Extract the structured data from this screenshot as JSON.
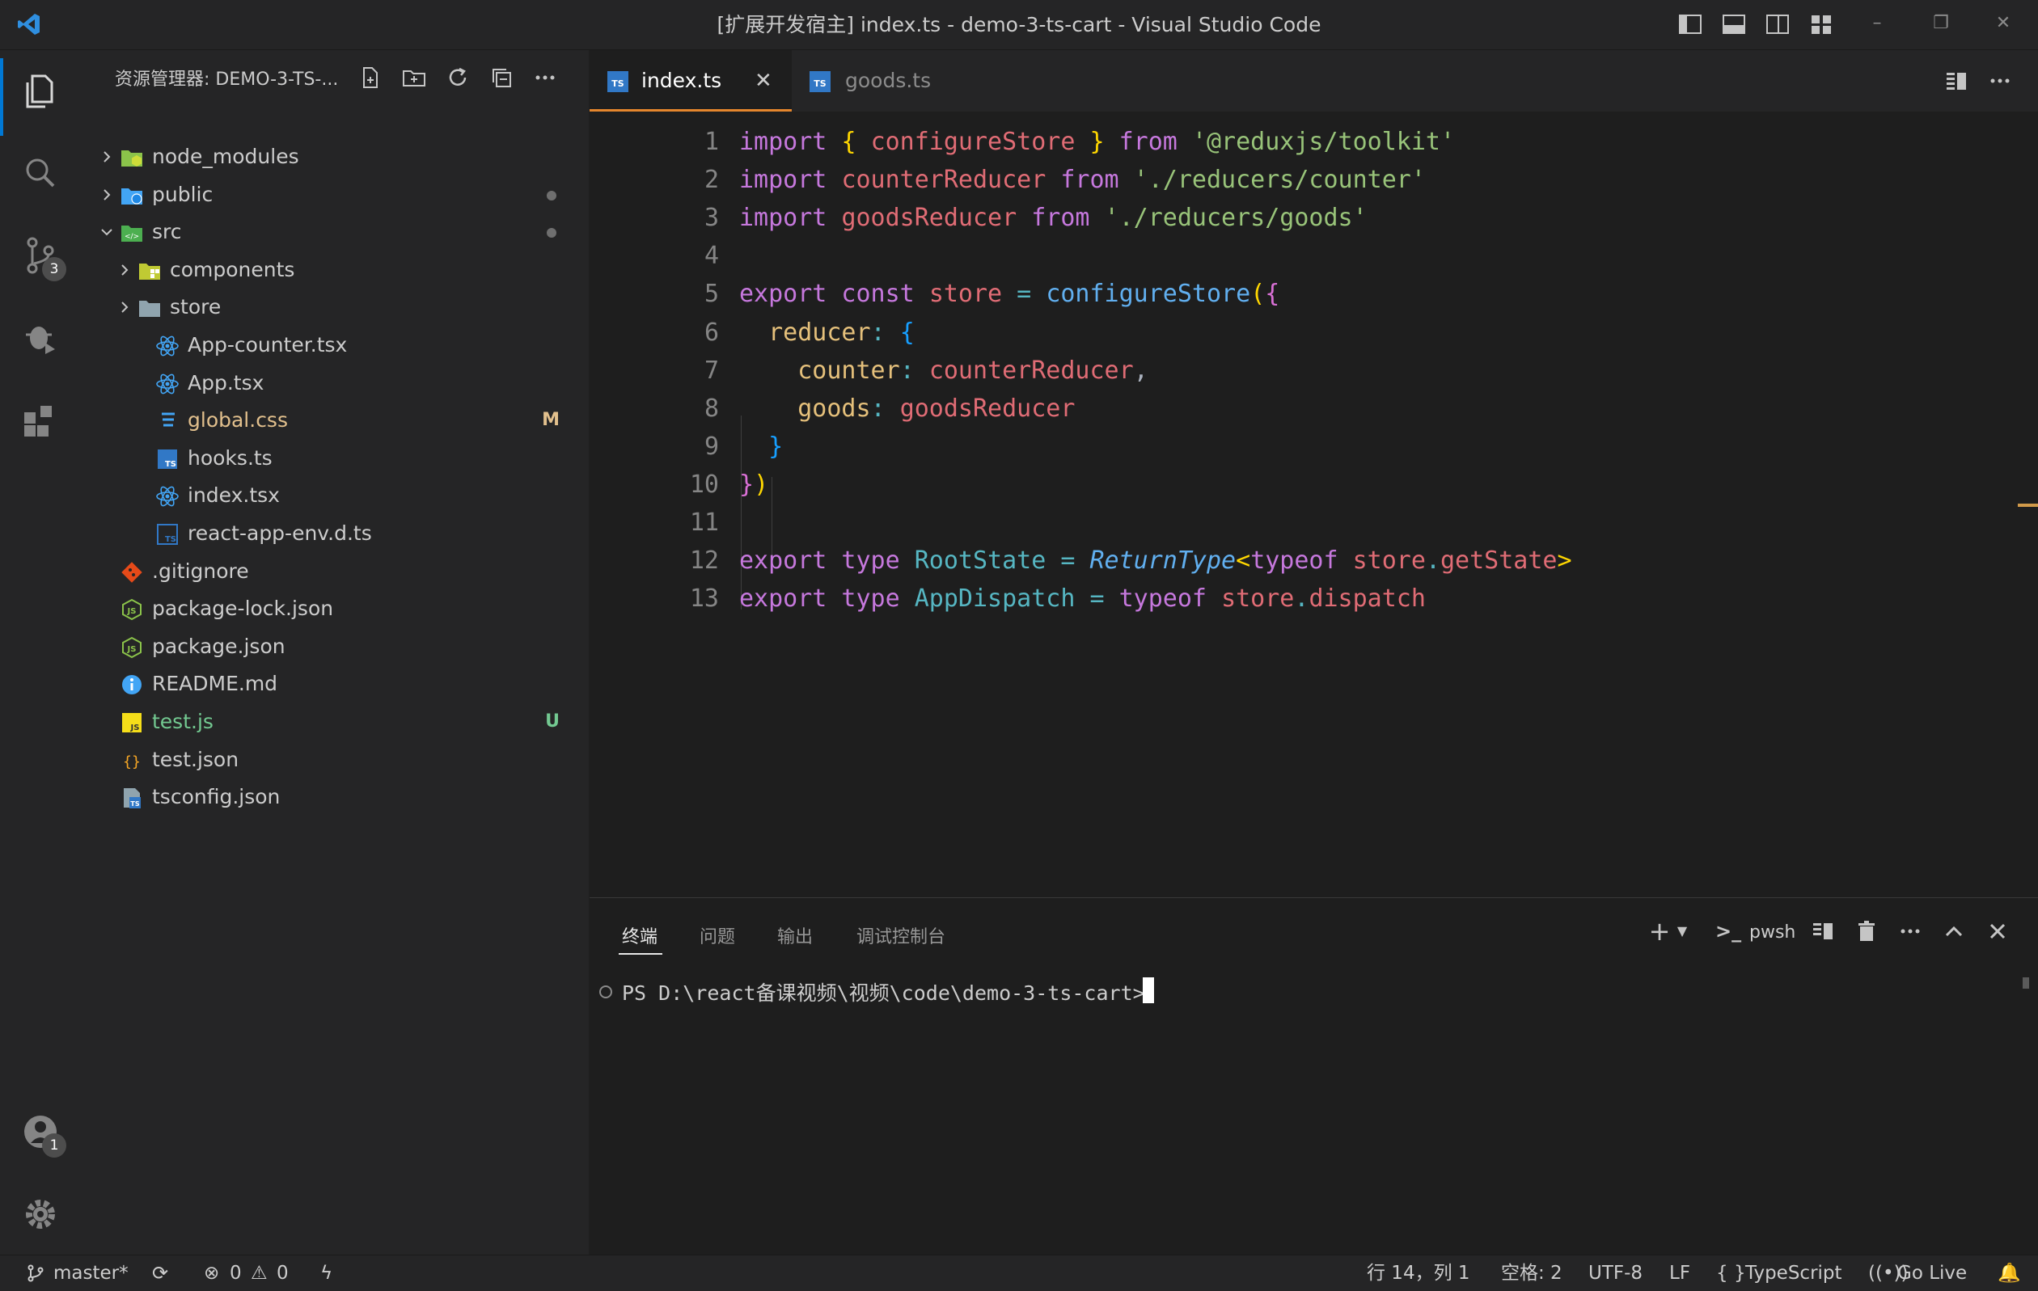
{
  "window": {
    "title": "[扩展开发宿主] index.ts - demo-3-ts-cart - Visual Studio Code"
  },
  "activity_bar": {
    "source_control_badge": "3",
    "accounts_badge": "1"
  },
  "sidebar": {
    "header": "资源管理器: DEMO-3-TS-...",
    "tree": [
      {
        "label": "node_modules",
        "type": "folder",
        "expanded": false,
        "icon": "node-folder-icon",
        "decoration": ""
      },
      {
        "label": "public",
        "type": "folder",
        "expanded": false,
        "icon": "public-folder-icon",
        "decoration": "•"
      },
      {
        "label": "src",
        "type": "folder",
        "expanded": true,
        "icon": "src-folder-icon",
        "decoration": "•"
      },
      {
        "label": "components",
        "type": "folder",
        "expanded": false,
        "icon": "components-folder-icon",
        "decoration": ""
      },
      {
        "label": "store",
        "type": "folder",
        "expanded": false,
        "icon": "folder-icon",
        "decoration": ""
      },
      {
        "label": "App-counter.tsx",
        "type": "file",
        "icon": "react-icon",
        "decoration": ""
      },
      {
        "label": "App.tsx",
        "type": "file",
        "icon": "react-icon",
        "decoration": ""
      },
      {
        "label": "global.css",
        "type": "file",
        "icon": "css-icon",
        "decoration": "M"
      },
      {
        "label": "hooks.ts",
        "type": "file",
        "icon": "typescript-icon",
        "decoration": ""
      },
      {
        "label": "index.tsx",
        "type": "file",
        "icon": "react-icon",
        "decoration": ""
      },
      {
        "label": "react-app-env.d.ts",
        "type": "file",
        "icon": "typescript-def-icon",
        "decoration": ""
      },
      {
        "label": ".gitignore",
        "type": "file",
        "icon": "git-icon",
        "decoration": ""
      },
      {
        "label": "package-lock.json",
        "type": "file",
        "icon": "nodejs-icon",
        "decoration": ""
      },
      {
        "label": "package.json",
        "type": "file",
        "icon": "nodejs-icon",
        "decoration": ""
      },
      {
        "label": "README.md",
        "type": "file",
        "icon": "info-icon",
        "decoration": ""
      },
      {
        "label": "test.js",
        "type": "file",
        "icon": "javascript-icon",
        "decoration": "U"
      },
      {
        "label": "test.json",
        "type": "file",
        "icon": "json-icon",
        "decoration": ""
      },
      {
        "label": "tsconfig.json",
        "type": "file",
        "icon": "tsconfig-icon",
        "decoration": ""
      }
    ]
  },
  "tabs": [
    {
      "label": "index.ts",
      "active": true
    },
    {
      "label": "goods.ts",
      "active": false
    }
  ],
  "tab_icon_text": "TS",
  "editor": {
    "line_numbers": [
      "1",
      "2",
      "3",
      "4",
      "5",
      "6",
      "7",
      "8",
      "9",
      "10",
      "11",
      "12",
      "13"
    ],
    "lines": [
      [
        [
          "kw",
          "import "
        ],
        [
          "br1",
          "{ "
        ],
        [
          "var",
          "configureStore"
        ],
        [
          "br1",
          " }"
        ],
        [
          "kw",
          " from "
        ],
        [
          "str",
          "'@reduxjs/toolkit'"
        ]
      ],
      [
        [
          "kw",
          "import "
        ],
        [
          "var",
          "counterReducer"
        ],
        [
          "kw",
          " from "
        ],
        [
          "str",
          "'./reducers/counter'"
        ]
      ],
      [
        [
          "kw",
          "import "
        ],
        [
          "var",
          "goodsReducer"
        ],
        [
          "kw",
          " from "
        ],
        [
          "str",
          "'./reducers/goods'"
        ]
      ],
      [],
      [
        [
          "kw",
          "export const "
        ],
        [
          "var",
          "store"
        ],
        [
          "op",
          " = "
        ],
        [
          "fn",
          "configureStore"
        ],
        [
          "br1",
          "("
        ],
        [
          "br2",
          "{"
        ]
      ],
      [
        [
          "plain",
          "  "
        ],
        [
          "prop",
          "reducer"
        ],
        [
          "op",
          ": "
        ],
        [
          "br3",
          "{"
        ]
      ],
      [
        [
          "plain",
          "    "
        ],
        [
          "prop",
          "counter"
        ],
        [
          "op",
          ": "
        ],
        [
          "var",
          "counterReducer"
        ],
        [
          "plain",
          ","
        ]
      ],
      [
        [
          "plain",
          "    "
        ],
        [
          "prop",
          "goods"
        ],
        [
          "op",
          ": "
        ],
        [
          "var",
          "goodsReducer"
        ]
      ],
      [
        [
          "plain",
          "  "
        ],
        [
          "br3",
          "}"
        ]
      ],
      [
        [
          "br2",
          "}"
        ],
        [
          "br1",
          ")"
        ]
      ],
      [],
      [
        [
          "kw",
          "export type "
        ],
        [
          "type",
          "RootState"
        ],
        [
          "op",
          " = "
        ],
        [
          "ital",
          "ReturnType"
        ],
        [
          "br1",
          "<"
        ],
        [
          "kw",
          "typeof "
        ],
        [
          "var",
          "store"
        ],
        [
          "op",
          "."
        ],
        [
          "var",
          "getState"
        ],
        [
          "br1",
          ">"
        ]
      ],
      [
        [
          "kw",
          "export type "
        ],
        [
          "type",
          "AppDispatch"
        ],
        [
          "op",
          " = "
        ],
        [
          "kw",
          "typeof "
        ],
        [
          "var",
          "store"
        ],
        [
          "op",
          "."
        ],
        [
          "var",
          "dispatch"
        ]
      ]
    ]
  },
  "panel": {
    "tabs": [
      "终端",
      "问题",
      "输出",
      "调试控制台"
    ],
    "active_tab": "终端",
    "terminal_name": "pwsh",
    "prompt": "PS D:\\react备课视频\\视频\\code\\demo-3-ts-cart>"
  },
  "status_bar": {
    "branch": "master*",
    "errors": "0",
    "warnings": "0",
    "position": "行 14，列 1",
    "spaces": "空格: 2",
    "encoding": "UTF-8",
    "eol": "LF",
    "language": "TypeScript",
    "golive": "Go Live"
  },
  "colors": {
    "accent": "#0078d4",
    "active_tab_border": "#e5862d",
    "modified": "#e2c08d",
    "untracked": "#73c991"
  }
}
